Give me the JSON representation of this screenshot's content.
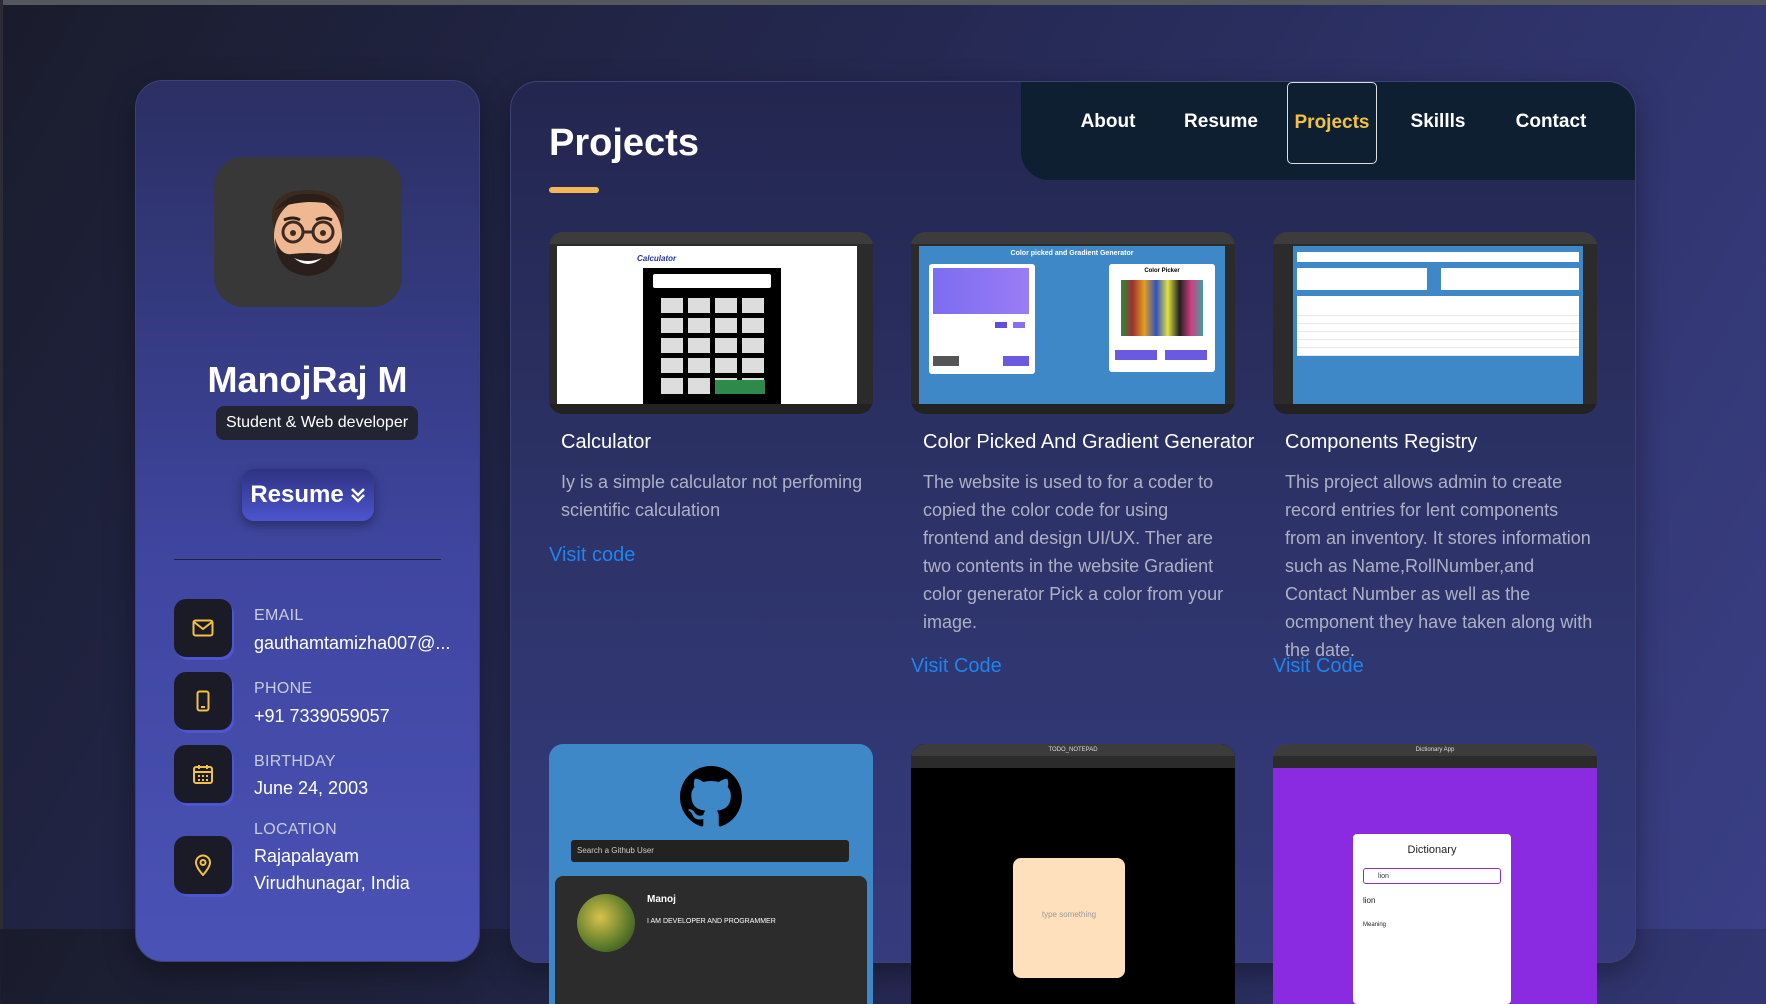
{
  "profile": {
    "name": "ManojRaj M",
    "title": "Student & Web developer",
    "resume_label": "Resume"
  },
  "contacts": [
    {
      "label": "EMAIL",
      "value": "gauthamtamizha007@...",
      "icon": "mail-icon"
    },
    {
      "label": "PHONE",
      "value": "+91 7339059057",
      "icon": "phone-icon"
    },
    {
      "label": "BIRTHDAY",
      "value": "June 24, 2003",
      "icon": "calendar-icon"
    },
    {
      "label": "LOCATION",
      "value_line1": "Rajapalayam",
      "value_line2": "Virudhunagar, India",
      "icon": "location-pin-icon"
    }
  ],
  "nav": {
    "items": [
      "About",
      "Resume",
      "Projects",
      "Skillls",
      "Contact"
    ],
    "active": "Projects"
  },
  "page": {
    "title": "Projects"
  },
  "projects": [
    {
      "title": "Calculator",
      "description": "Iy is a simple calculator not perfoming scientific calculation",
      "link": "Visit code",
      "thumb_text": "Calculator"
    },
    {
      "title": "Color Picked And Gradient Generator",
      "description": "The website is used to for a coder to copied the color code for using frontend and design UI/UX. Ther are two contents in the website Gradient color generator Pick a color from your image.",
      "link": "Visit Code",
      "thumb_text": "Color picked and Gradient Generator",
      "thumb_subtext": "Color Picker"
    },
    {
      "title": "Components Registry",
      "description": "This project allows admin to create record entries for lent components from an inventory. It stores information such as Name,RollNumber,and Contact Number as well as the ocmponent they have taken along with the date.",
      "link": "Visit Code"
    }
  ],
  "projects_row2": [
    {
      "search_placeholder": "Search a Github User",
      "user_name": "Manoj",
      "user_bio": "I AM DEVELOPER AND PROGRAMMER"
    },
    {
      "tab": "TODO_NOTEPAD",
      "note_placeholder": "type something"
    },
    {
      "tab": "Dictionary App",
      "heading": "Dictionary",
      "search_value": "lion",
      "result_word": "lion",
      "result_label": "Meaning"
    }
  ],
  "colors": {
    "accent": "#f1c143",
    "link": "#1e84f0",
    "nav_bg": "#0e1f32"
  }
}
